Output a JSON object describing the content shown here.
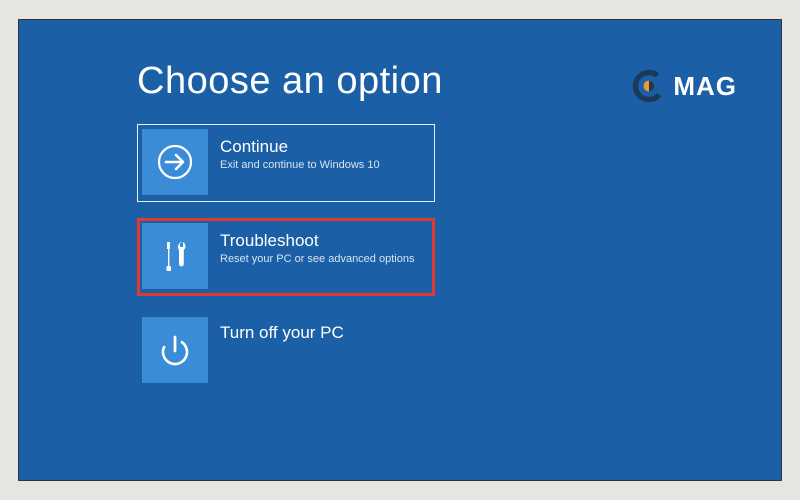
{
  "title": "Choose an option",
  "options": [
    {
      "label": "Continue",
      "desc": "Exit and continue to Windows 10"
    },
    {
      "label": "Troubleshoot",
      "desc": "Reset your PC or see advanced options"
    },
    {
      "label": "Turn off your PC",
      "desc": ""
    }
  ],
  "logo": {
    "text": "MAG"
  },
  "colors": {
    "background": "#1b5fa6",
    "tile": "#3a8cd6",
    "highlight": "#e03a2e"
  }
}
